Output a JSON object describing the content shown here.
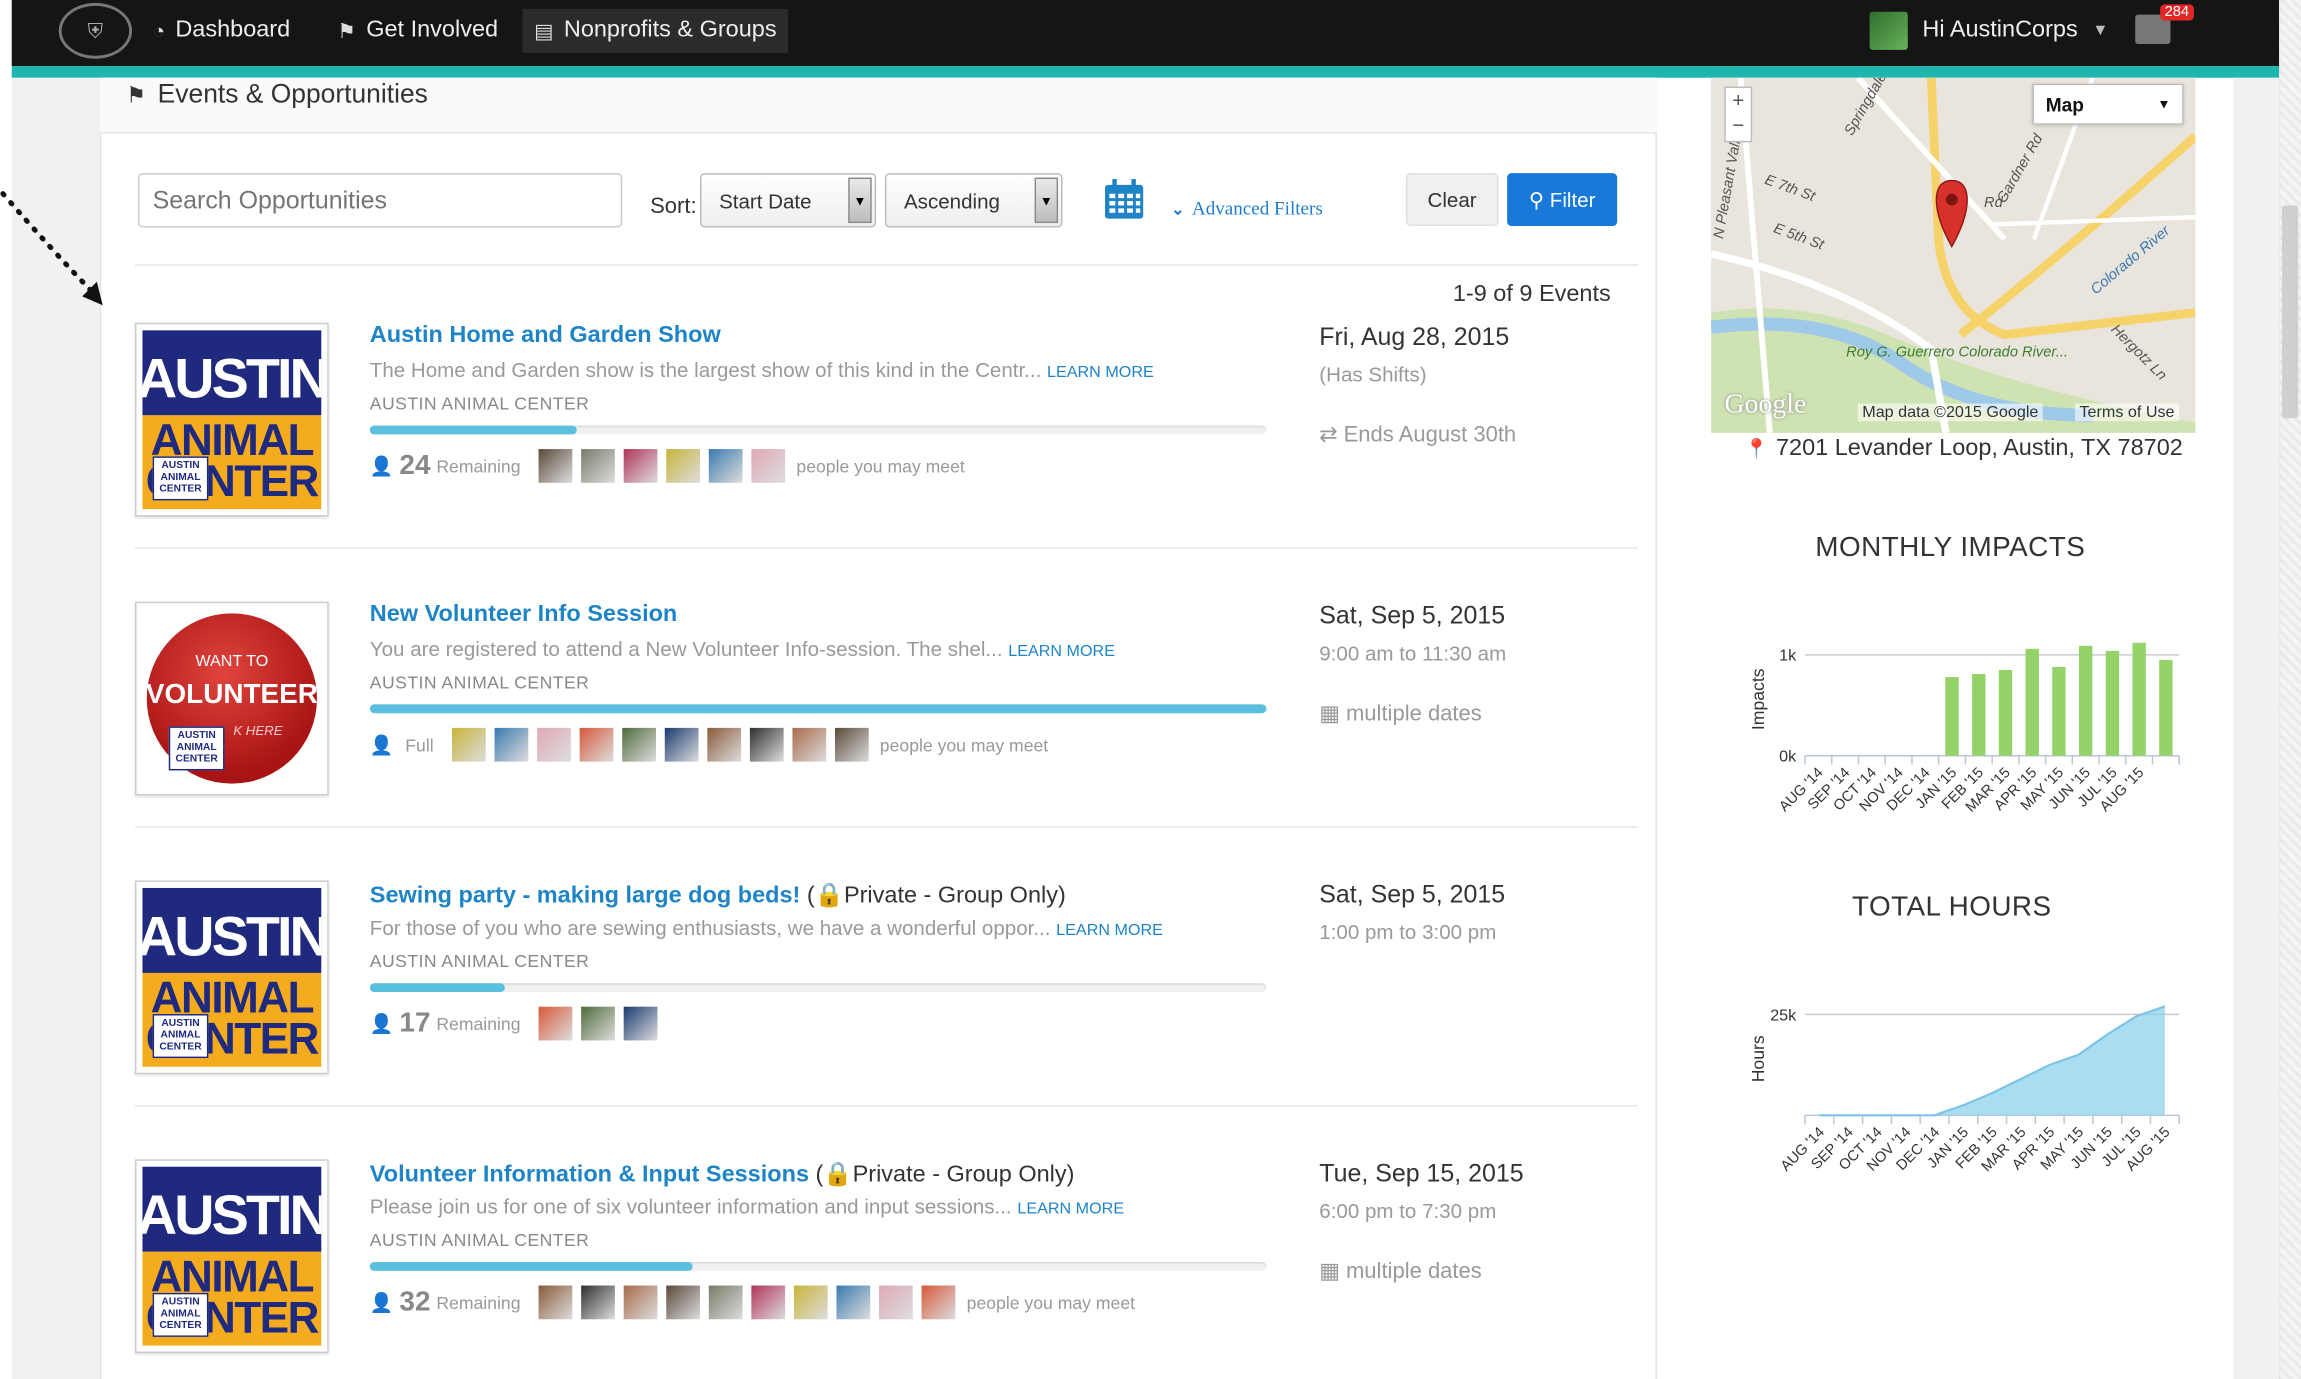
{
  "nav": {
    "items": [
      {
        "label": "Dashboard",
        "icon": "dashboard-icon"
      },
      {
        "label": "Get Involved",
        "icon": "flag-icon"
      },
      {
        "label": "Nonprofits & Groups",
        "icon": "building-icon",
        "active": true
      }
    ],
    "user_greeting": "Hi AustinCorps",
    "mail_count": "284"
  },
  "panel": {
    "title": "Events & Opportunities",
    "search_placeholder": "Search Opportunities",
    "sort_label": "Sort:",
    "sort_field": "Start Date",
    "sort_order": "Ascending",
    "advanced_filters": "Advanced Filters",
    "clear_label": "Clear",
    "filter_label": "Filter",
    "result_count": "1-9 of 9 Events"
  },
  "events": [
    {
      "title": "Austin Home and Garden Show",
      "private": "",
      "description": "The Home and Garden show is the largest show of this kind in the Centr...",
      "learn_more": "LEARN MORE",
      "org": "AUSTIN ANIMAL CENTER",
      "progress": 0.23,
      "remaining_num": "24",
      "remaining_label": "Remaining",
      "avatar_count": 6,
      "meet": "people you may meet",
      "date": "Fri, Aug 28, 2015",
      "time": "(Has Shifts)",
      "extra": "Ends August 30th",
      "extra_icon": "exchange-icon",
      "image": "aac"
    },
    {
      "title": "New Volunteer Info Session",
      "private": "",
      "description": "You are registered to attend a New Volunteer Info-session.  The shel...",
      "learn_more": "LEARN MORE",
      "org": "AUSTIN ANIMAL CENTER",
      "progress": 1.0,
      "remaining_num": "",
      "remaining_label": "Full",
      "avatar_count": 10,
      "meet": "people you may meet",
      "date": "Sat, Sep 5, 2015",
      "time": "9:00 am to 11:30 am",
      "extra": "multiple dates",
      "extra_icon": "calendar-icon",
      "image": "volunteer"
    },
    {
      "title": "Sewing party - making large dog beds!",
      "private": "Private - Group Only)",
      "description": "For those of you who are sewing enthusiasts, we have a wonderful oppor...",
      "learn_more": "LEARN MORE",
      "org": "AUSTIN ANIMAL CENTER",
      "progress": 0.15,
      "remaining_num": "17",
      "remaining_label": "Remaining",
      "avatar_count": 3,
      "meet": "",
      "date": "Sat, Sep 5, 2015",
      "time": "1:00 pm to 3:00 pm",
      "extra": "",
      "extra_icon": "",
      "image": "aac"
    },
    {
      "title": "Volunteer Information & Input Sessions",
      "private": "Private - Group Only)",
      "description": "Please join us for one of six volunteer information and input sessions...",
      "learn_more": "LEARN MORE",
      "org": "AUSTIN ANIMAL CENTER",
      "progress": 0.36,
      "remaining_num": "32",
      "remaining_label": "Remaining",
      "avatar_count": 10,
      "meet": "people you may meet",
      "date": "Tue, Sep 15, 2015",
      "time": "6:00 pm to 7:30 pm",
      "extra": "multiple dates",
      "extra_icon": "calendar-icon",
      "image": "aac"
    }
  ],
  "logo_text": {
    "austin": "AUSTIN",
    "animal": "ANIMAL",
    "center": "CENTER",
    "mini": "AUSTIN ANIMAL CENTER",
    "want_to": "WANT TO",
    "volunteer": "VOLUNTEER",
    "click_here": "K HERE"
  },
  "map": {
    "type_label": "Map",
    "credit": "Map data ©2015 Google",
    "terms": "Terms of Use",
    "google": "Google",
    "address": "7201 Levander Loop, Austin, TX 78702",
    "labels": [
      "Springdale Rd",
      "E 7th St",
      "E 5th St",
      "Gardner Rd",
      "Colorado River",
      "Hergotz Ln",
      "Roy G. Guerrero Colorado River...",
      "Rd",
      "N Pleasant Valley Rd"
    ]
  },
  "chart_data": [
    {
      "type": "bar",
      "title": "MONTHLY IMPACTS",
      "ylabel": "Impacts",
      "xlabel": "",
      "categories": [
        "AUG '14",
        "SEP '14",
        "OCT '14",
        "NOV '14",
        "DEC '14",
        "JAN '15",
        "FEB '15",
        "MAR '15",
        "APR '15",
        "MAY '15",
        "JUN '15",
        "JUL '15",
        "AUG '15"
      ],
      "values": [
        0,
        0,
        0,
        0,
        0,
        780,
        810,
        850,
        1060,
        880,
        1090,
        1040,
        1120,
        950
      ],
      "yticks": [
        "0k",
        "1k"
      ],
      "ylim": [
        0,
        1000
      ],
      "color": "#94d369"
    },
    {
      "type": "area",
      "title": "TOTAL HOURS",
      "ylabel": "Hours",
      "xlabel": "",
      "categories": [
        "AUG '14",
        "SEP '14",
        "OCT '14",
        "NOV '14",
        "DEC '14",
        "JAN '15",
        "FEB '15",
        "MAR '15",
        "APR '15",
        "MAY '15",
        "JUN '15",
        "JUL '15",
        "AUG '15"
      ],
      "values": [
        0,
        0,
        0,
        0,
        0,
        2500,
        5500,
        9000,
        12500,
        15000,
        20000,
        24500,
        27000
      ],
      "yticks": [
        "25k"
      ],
      "ylim": [
        0,
        25000
      ],
      "color": "#87ceeb"
    }
  ]
}
